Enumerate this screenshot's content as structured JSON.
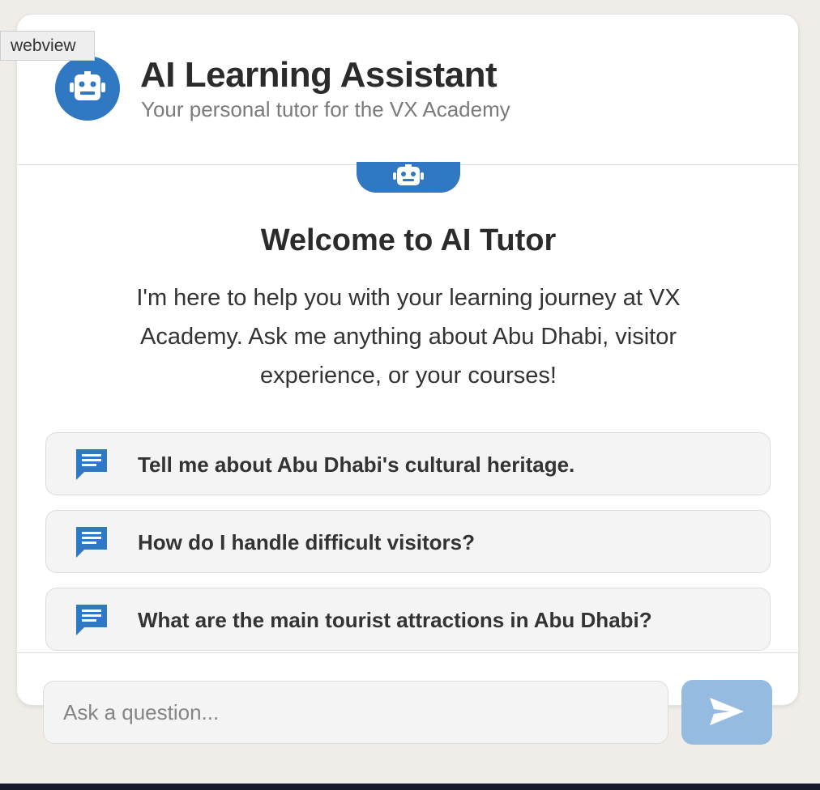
{
  "webview_tag": "webview",
  "header": {
    "title": "AI Learning Assistant",
    "subtitle": "Your personal tutor for the VX Academy",
    "avatar_icon": "robot-icon"
  },
  "welcome": {
    "badge_icon": "robot-icon",
    "title": "Welcome to AI Tutor",
    "text": "I'm here to help you with your learning journey at VX Academy. Ask me anything about Abu Dhabi, visitor experience, or your courses!"
  },
  "suggestions": [
    {
      "icon": "chat-bubble-icon",
      "label": "Tell me about Abu Dhabi's cultural heritage."
    },
    {
      "icon": "chat-bubble-icon",
      "label": "How do I handle difficult visitors?"
    },
    {
      "icon": "chat-bubble-icon",
      "label": "What are the main tourist attractions in Abu Dhabi?"
    }
  ],
  "composer": {
    "placeholder": "Ask a question...",
    "value": "",
    "send_icon": "send-icon"
  },
  "colors": {
    "accent": "#3078c2",
    "send_button_disabled": "#96bbe0",
    "background": "#f0ede8"
  }
}
